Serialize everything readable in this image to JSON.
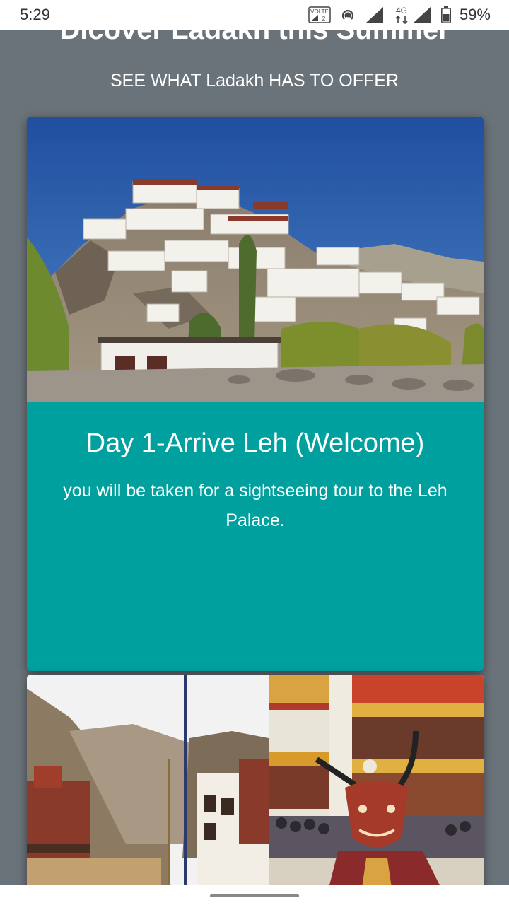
{
  "status_bar": {
    "time": "5:29",
    "volte_badge": "VOLTE",
    "volte_sub": "2",
    "network": "4G",
    "battery": "59%",
    "icons": [
      "volte-icon",
      "hotspot-icon",
      "signal-icon",
      "signal-4g-icon",
      "battery-icon"
    ]
  },
  "header": {
    "title": "Dicover Ladakh this Summer",
    "subtitle": "SEE WHAT Ladakh HAS TO OFFER"
  },
  "cards": [
    {
      "image": "monastery-hill-photo",
      "title": "Day 1-Arrive Leh (Welcome)",
      "text": "you will be taken for a sightseeing tour to the Leh Palace."
    },
    {
      "image": "hemis-monastery-mask-dance-photo"
    }
  ],
  "colors": {
    "background": "#6b737a",
    "card": "#00a09f",
    "text": "#ffffff"
  }
}
